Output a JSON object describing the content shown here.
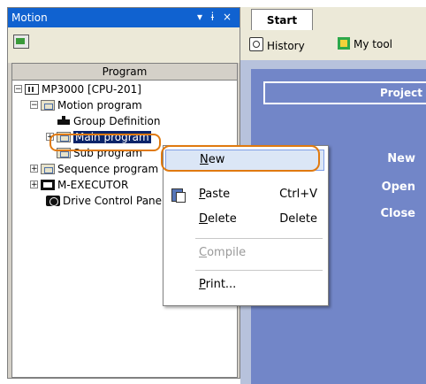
{
  "motion_panel": {
    "title": "Motion",
    "window_controls": "▾ ɨ ×",
    "tree_header": "Program",
    "tree": [
      {
        "label": "MP3000 [CPU-201]"
      },
      {
        "label": "Motion program"
      },
      {
        "label": "Group Definition"
      },
      {
        "label": "Main program"
      },
      {
        "label": "Sub program"
      },
      {
        "label": "Sequence program"
      },
      {
        "label": "M-EXECUTOR"
      },
      {
        "label": "Drive Control Panel"
      }
    ]
  },
  "start_tab": {
    "tab_label": "Start",
    "toolbar": {
      "history": "History",
      "mytool": "My tool"
    },
    "projects_header": "Project",
    "links": {
      "new": "New",
      "open": "Open",
      "close": "Close"
    }
  },
  "context_menu": {
    "items": [
      {
        "label_u": "N",
        "label_rest": "ew",
        "shortcut": ""
      },
      {
        "label_u": "P",
        "label_rest": "aste",
        "shortcut": "Ctrl+V"
      },
      {
        "label_u": "D",
        "label_rest": "elete",
        "shortcut": "Delete"
      },
      {
        "label_u": "C",
        "label_rest": "ompile",
        "shortcut": ""
      },
      {
        "label_u": "P",
        "label_rest": "rint...",
        "shortcut": ""
      }
    ]
  },
  "colors": {
    "titlebar": "#1062d0",
    "selection": "#0a246a",
    "highlight_outline": "#e07a10",
    "start_panel": "#7286c8"
  }
}
